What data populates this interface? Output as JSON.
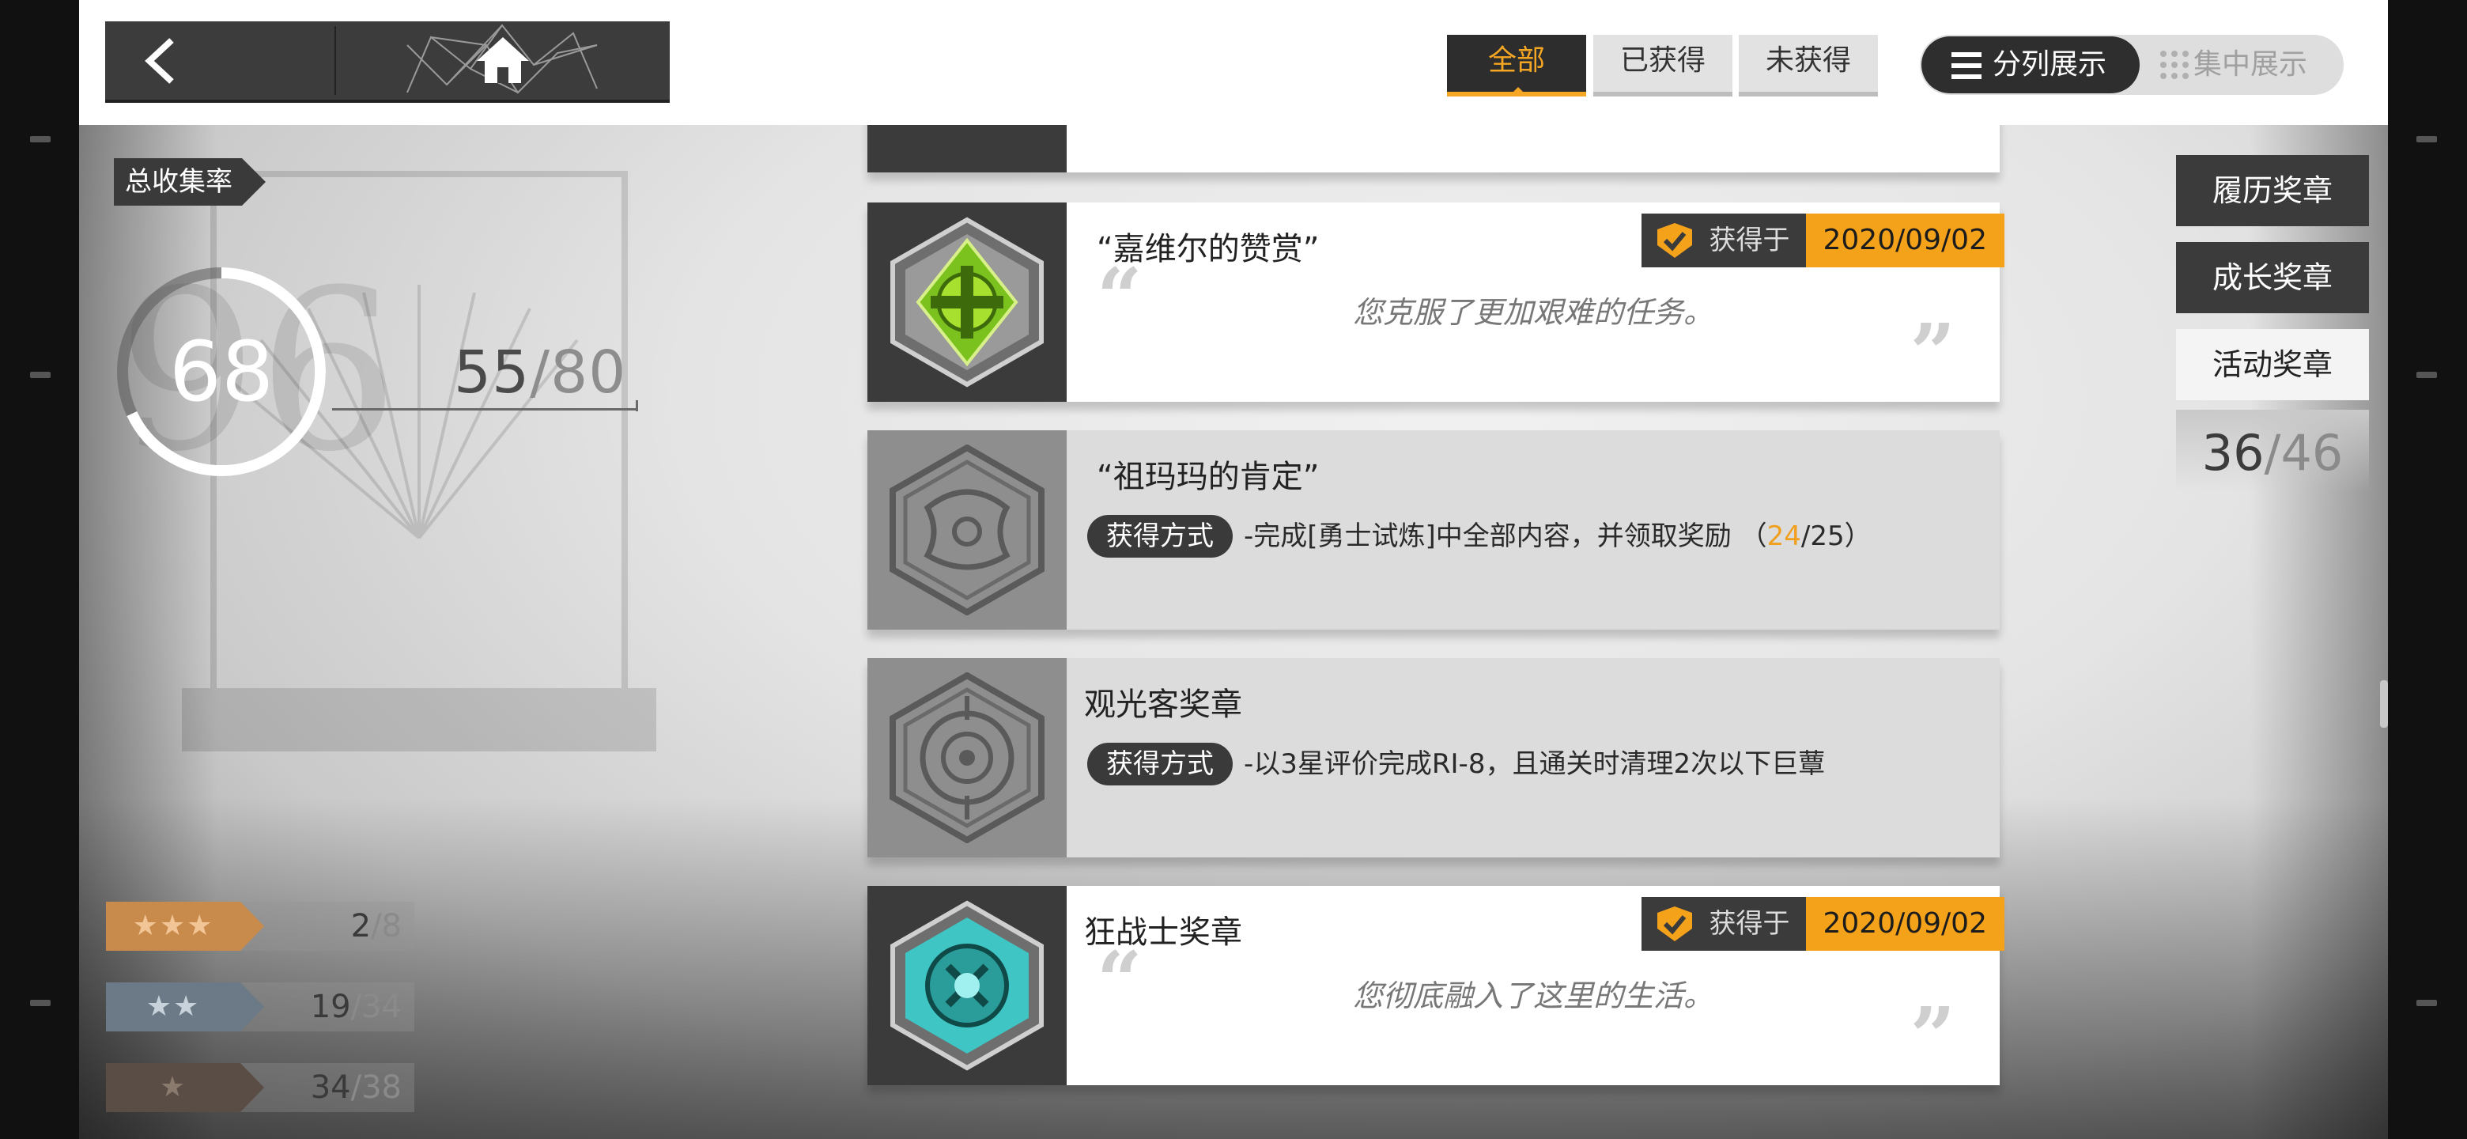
{
  "nav": {
    "back_icon": "chevron-left-icon",
    "home_icon": "home-icon"
  },
  "filters": {
    "all": "全部",
    "obtained": "已获得",
    "not_obtained": "未获得",
    "selected": "all"
  },
  "view_mode": {
    "split": "分列展示",
    "focus": "集中展示",
    "selected": "split"
  },
  "collection": {
    "label": "总收集率",
    "rate": "68",
    "obtained": "55",
    "total": "80",
    "rate_fraction": 0.68
  },
  "stars": [
    {
      "stars": "★★★",
      "obtained": "2",
      "total": "8",
      "color": "#c98b4b"
    },
    {
      "stars": "★★",
      "obtained": "19",
      "total": "34",
      "color": "#6b7a86"
    },
    {
      "stars": "★",
      "obtained": "34",
      "total": "38",
      "color": "#5a4d45"
    }
  ],
  "medals": [
    {
      "title": "“嘉维尔的赞赏”",
      "state": "obtained",
      "obtained_label": "获得于",
      "date": "2020/09/02",
      "desc": "您克服了更加艰难的任务。",
      "icon": "green-cross-medal-icon"
    },
    {
      "title": "“祖玛玛的肯定”",
      "state": "locked",
      "method_label": "获得方式",
      "method_prefix": "-完成[勇士试炼]中全部内容，并领取奖励 （",
      "progress_current": "24",
      "progress_sep_total": "/25）",
      "icon": "dragon-medal-icon"
    },
    {
      "title": "观光客奖章",
      "state": "locked",
      "method_label": "获得方式",
      "method_text": "-以3星评价完成RI-8，且通关时清理2次以下巨蕈",
      "icon": "eye-target-medal-icon"
    },
    {
      "title": "狂战士奖章",
      "state": "obtained",
      "obtained_label": "获得于",
      "date": "2020/09/02",
      "desc": "您彻底融入了这里的生活。",
      "icon": "teal-berserker-medal-icon"
    }
  ],
  "categories": {
    "history": "履历奖章",
    "growth": "成长奖章",
    "event": "活动奖章",
    "selected": "event",
    "event_obtained": "36",
    "event_total": "46"
  },
  "colors": {
    "accent": "#f5a21b",
    "dark": "#3b3b3b"
  }
}
